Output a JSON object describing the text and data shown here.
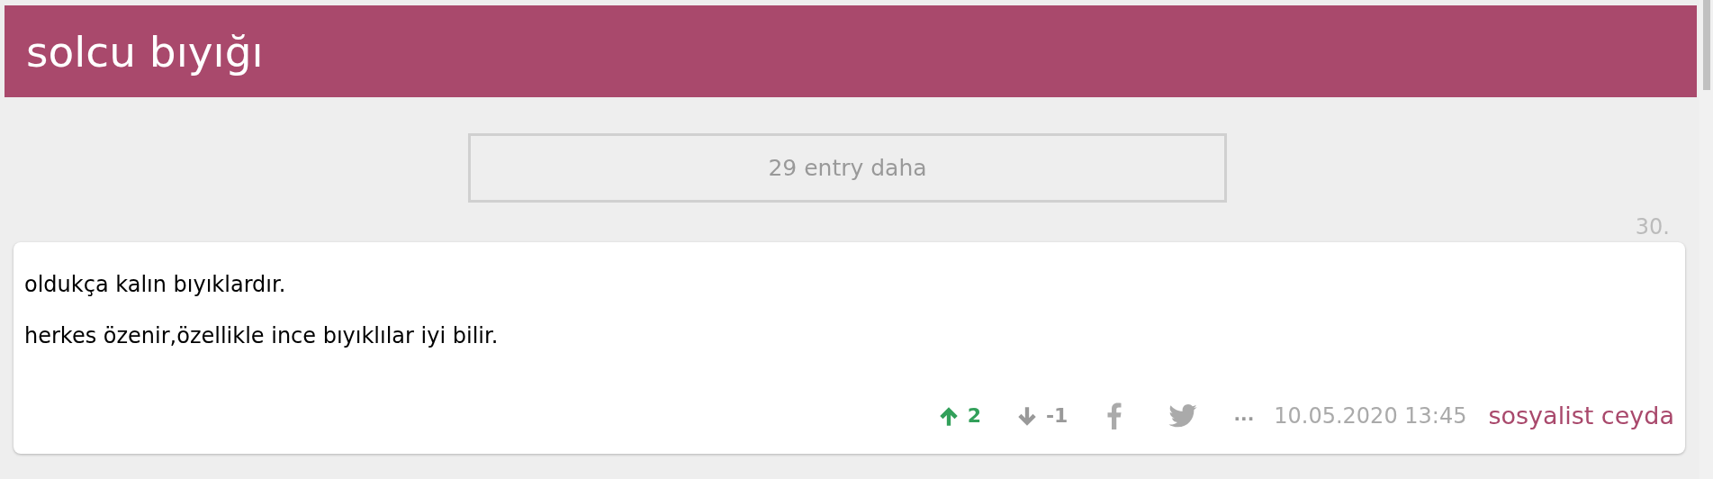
{
  "topic": {
    "title": "solcu bıyığı"
  },
  "more_entries": {
    "label": "29 entry daha"
  },
  "entry": {
    "number": "30.",
    "lines": [
      "oldukça kalın bıyıklardır.",
      "herkes özenir,özellikle ince bıyıklılar iyi bilir."
    ],
    "votes": [
      {
        "kind": "up",
        "count": "2",
        "selected": true
      },
      {
        "kind": "down",
        "count": "-1",
        "selected": false
      }
    ],
    "more": "...",
    "date": "10.05.2020 13:45",
    "author": "sosyalist ceyda"
  }
}
